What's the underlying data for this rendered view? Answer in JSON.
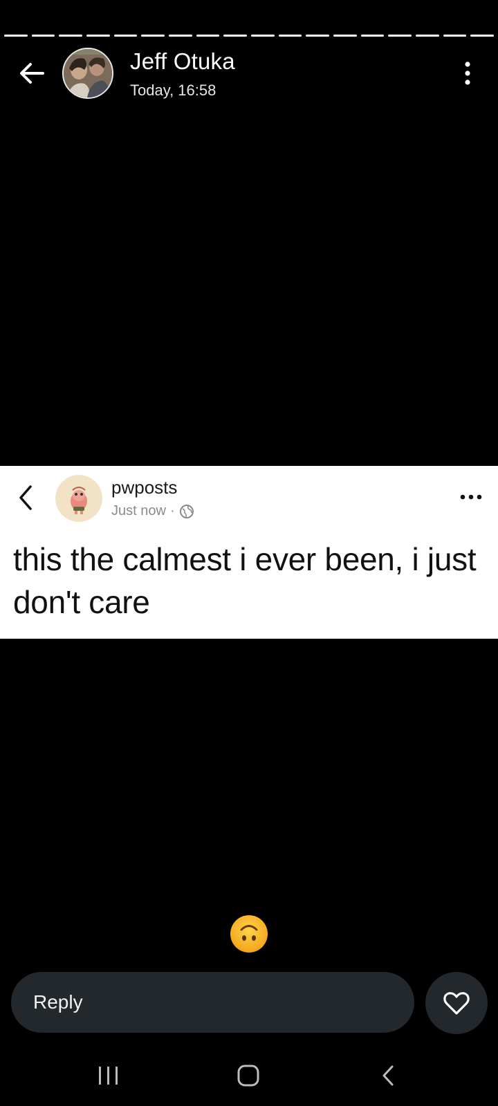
{
  "story": {
    "segment_count": 18,
    "user_name": "Jeff Otuka",
    "timestamp": "Today, 16:58"
  },
  "post": {
    "username": "pwposts",
    "meta_time": "Just now",
    "meta_separator": "·",
    "text": "this the calmest i ever been, i just don't care"
  },
  "reply": {
    "placeholder": "Reply"
  },
  "icons": {
    "back": "arrow-left-icon",
    "more": "more-vertical-icon",
    "heart": "heart-icon",
    "globe": "globe-icon",
    "emoji": "upside-down-face-emoji"
  },
  "colors": {
    "background": "#000000",
    "reply_bg": "#22282b",
    "card_bg": "#ffffff",
    "meta_gray": "#8a8a8a"
  }
}
